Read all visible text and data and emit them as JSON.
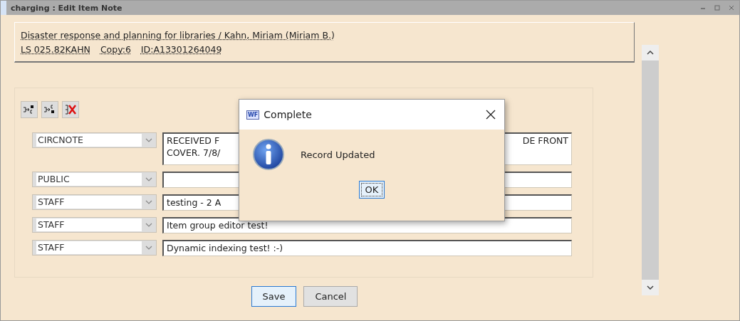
{
  "window": {
    "title": "charging : Edit Item Note"
  },
  "item": {
    "title_line": "Disaster response and planning for libraries / Kahn, Miriam (Miriam B.)",
    "call_number": "LS 025.82KAHN",
    "copy": "Copy:6",
    "id": "ID:A13301264049"
  },
  "notes": [
    {
      "type": "CIRCNOTE",
      "text": "RECEIVED F\nCOVER. 7/8/",
      "text_right": "DE FRONT"
    },
    {
      "type": "PUBLIC"
    },
    {
      "type": "STAFF",
      "text": "testing - 2 A"
    },
    {
      "type": "STAFF",
      "text": "Item group editor test!"
    },
    {
      "type": "STAFF",
      "text": "Dynamic indexing test! :-)"
    }
  ],
  "buttons": [
    {
      "label": "Save",
      "focused": true
    },
    {
      "label": "Cancel",
      "focused": false
    }
  ],
  "dialog": {
    "app_badge": "WF",
    "title": "Complete",
    "message": "Record Updated",
    "button": "OK"
  }
}
